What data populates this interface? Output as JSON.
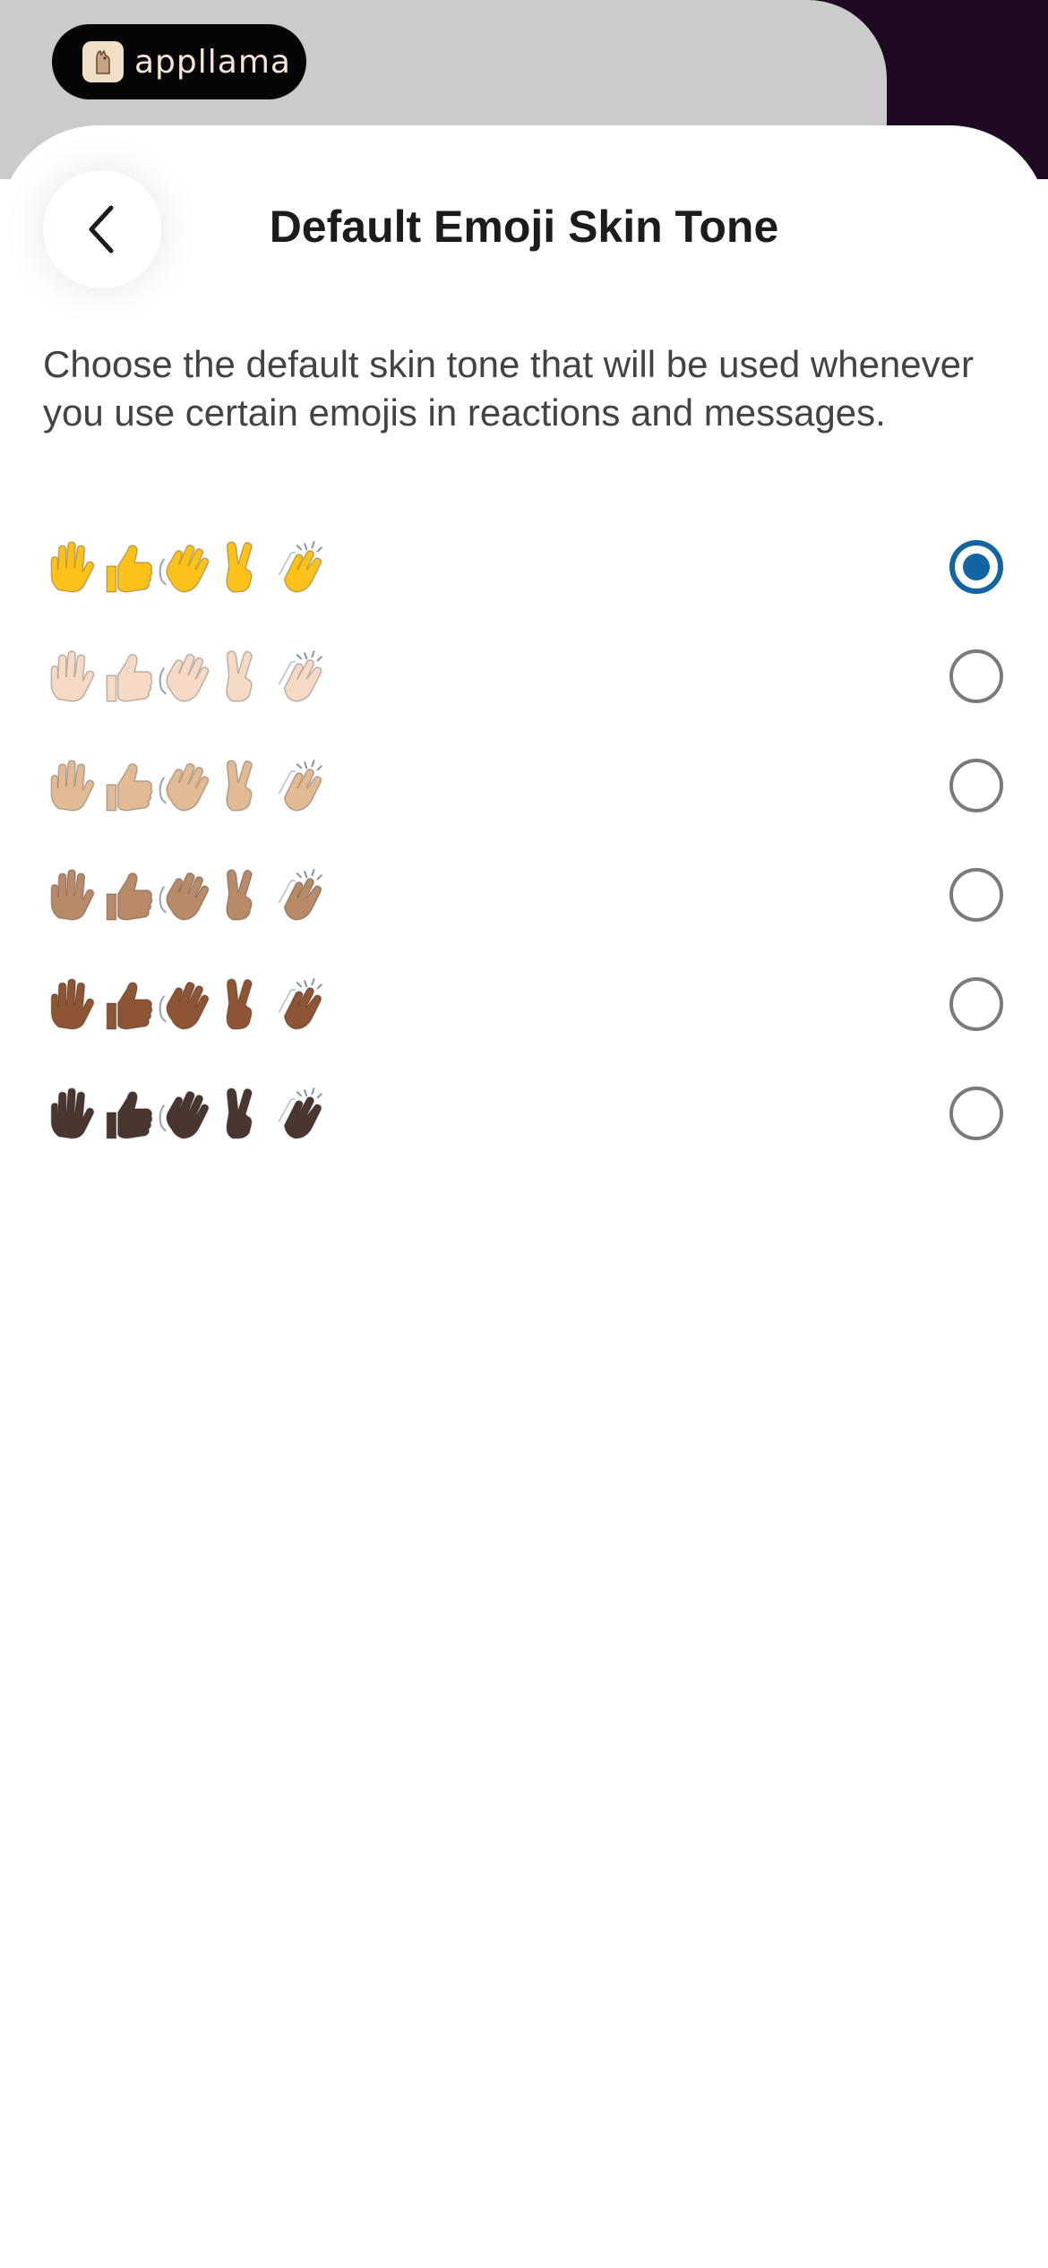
{
  "brand": {
    "name": "appllama"
  },
  "header": {
    "title": "Default Emoji Skin Tone",
    "back_icon": "chevron-left-icon"
  },
  "description": "Choose the default skin tone that will be used whenever you use certain emojis in reactions and messages.",
  "emojis": [
    "raised-hand-icon",
    "thumbs-up-icon",
    "waving-hand-icon",
    "victory-hand-icon",
    "clapping-hands-icon"
  ],
  "skin_tones": [
    {
      "name": "default",
      "color": "#fcc21b",
      "selected": true
    },
    {
      "name": "light",
      "color": "#f7dac5",
      "selected": false
    },
    {
      "name": "medium-light",
      "color": "#e2bb95",
      "selected": false
    },
    {
      "name": "medium",
      "color": "#b98a68",
      "selected": false
    },
    {
      "name": "medium-dark",
      "color": "#8d5534",
      "selected": false
    },
    {
      "name": "dark",
      "color": "#4a3631",
      "selected": false
    }
  ],
  "colors": {
    "accent": "#1264a3",
    "radio_border": "#7b7a7b",
    "backdrop_gray": "#cbcbcb",
    "backdrop_dark": "#1e0a20"
  }
}
